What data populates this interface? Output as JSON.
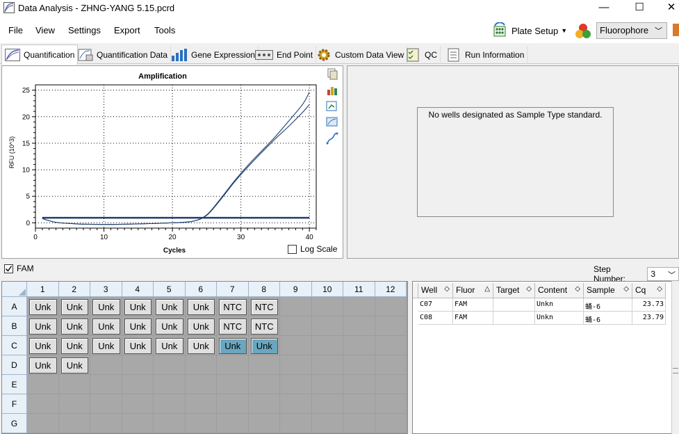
{
  "window": {
    "title": "Data Analysis - ZHNG-YANG 5.15.pcrd",
    "minimize": "—",
    "maximize": "☐",
    "close": "✕"
  },
  "menu": [
    "File",
    "View",
    "Settings",
    "Export",
    "Tools"
  ],
  "toolbar": {
    "plate_setup": "Plate Setup",
    "fluorophore": "Fluorophore"
  },
  "tabs": [
    "Quantification",
    "Quantification Data",
    "Gene Expression",
    "End Point",
    "Custom Data View",
    "QC",
    "Run Information"
  ],
  "chart": {
    "log_scale_label": "Log Scale"
  },
  "chart_data": {
    "type": "line",
    "title": "Amplification",
    "xlabel": "Cycles",
    "ylabel": "RFU (10^3)",
    "xlim": [
      0,
      41
    ],
    "ylim": [
      -1,
      26
    ],
    "xticks": [
      0,
      10,
      20,
      30,
      40
    ],
    "yticks": [
      0,
      5,
      10,
      15,
      20,
      25
    ],
    "grid": true,
    "series": [
      {
        "x": [
          1,
          3,
          6,
          10,
          15,
          20,
          23,
          25,
          27,
          29,
          31,
          33,
          35,
          37,
          39,
          40
        ],
        "y": [
          0.8,
          0.1,
          -0.2,
          -0.3,
          -0.2,
          0.0,
          0.3,
          1.5,
          4.5,
          7.8,
          10.8,
          13.5,
          16.2,
          19.2,
          22.3,
          24.6
        ]
      },
      {
        "x": [
          1,
          3,
          6,
          10,
          15,
          20,
          23,
          25,
          27,
          29,
          31,
          33,
          35,
          37,
          39,
          40
        ],
        "y": [
          0.8,
          0.1,
          -0.2,
          -0.3,
          -0.2,
          0.0,
          0.3,
          1.4,
          4.3,
          7.6,
          10.5,
          13.2,
          15.8,
          18.2,
          20.8,
          22.3
        ]
      },
      {
        "x": [
          1,
          40
        ],
        "y": [
          1.0,
          1.0
        ]
      },
      {
        "x": [
          1,
          40
        ],
        "y": [
          0.9,
          0.9
        ]
      }
    ]
  },
  "std_message": "No wells designated as Sample Type standard.",
  "fluor_filter": {
    "label": "FAM",
    "checked": true
  },
  "step": {
    "label": "Step Number:",
    "value": "3"
  },
  "plate": {
    "columns": [
      "1",
      "2",
      "3",
      "4",
      "5",
      "6",
      "7",
      "8",
      "9",
      "10",
      "11",
      "12"
    ],
    "rows": [
      "A",
      "B",
      "C",
      "D",
      "E",
      "F",
      "G"
    ],
    "wells": [
      [
        "Unk",
        "Unk",
        "Unk",
        "Unk",
        "Unk",
        "Unk",
        "NTC",
        "NTC",
        "",
        "",
        "",
        ""
      ],
      [
        "Unk",
        "Unk",
        "Unk",
        "Unk",
        "Unk",
        "Unk",
        "NTC",
        "NTC",
        "",
        "",
        "",
        ""
      ],
      [
        "Unk",
        "Unk",
        "Unk",
        "Unk",
        "Unk",
        "Unk",
        "Unk",
        "Unk",
        "",
        "",
        "",
        ""
      ],
      [
        "Unk",
        "Unk",
        "",
        "",
        "",
        "",
        "",
        "",
        "",
        "",
        "",
        ""
      ],
      [
        "",
        "",
        "",
        "",
        "",
        "",
        "",
        "",
        "",
        "",
        "",
        ""
      ],
      [
        "",
        "",
        "",
        "",
        "",
        "",
        "",
        "",
        "",
        "",
        "",
        ""
      ],
      [
        "",
        "",
        "",
        "",
        "",
        "",
        "",
        "",
        "",
        "",
        "",
        ""
      ]
    ],
    "selected": [
      [
        2,
        6
      ],
      [
        2,
        7
      ]
    ]
  },
  "results": {
    "headers": [
      "Well",
      "Fluor",
      "Target",
      "Content",
      "Sample",
      "Cq"
    ],
    "rows": [
      [
        "C07",
        "FAM",
        "",
        "Unkn",
        "蛹-6",
        "23.73"
      ],
      [
        "C08",
        "FAM",
        "",
        "Unkn",
        "蛹-6",
        "23.79"
      ]
    ]
  },
  "colors": {
    "curve": "#1f3f6e",
    "selected_well": "#6ba6bf",
    "header_bg": "#e8f0f8"
  }
}
